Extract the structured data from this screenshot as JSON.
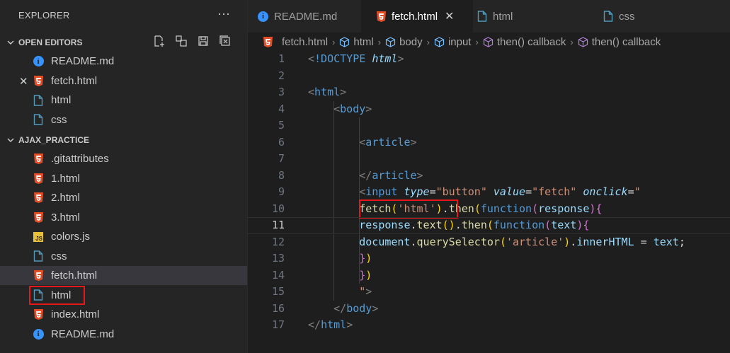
{
  "explorer": {
    "title": "EXPLORER",
    "more": "···",
    "open_editors": {
      "label": "OPEN EDITORS",
      "items": [
        {
          "name": "README.md",
          "icon": "info-icon"
        },
        {
          "name": "fetch.html",
          "icon": "html5-icon",
          "active": true
        },
        {
          "name": "html",
          "icon": "file-icon"
        },
        {
          "name": "css",
          "icon": "file-icon"
        }
      ]
    },
    "project": {
      "label": "AJAX_PRACTICE",
      "items": [
        {
          "name": ".gitattributes",
          "icon": "html5-icon"
        },
        {
          "name": "1.html",
          "icon": "html5-icon"
        },
        {
          "name": "2.html",
          "icon": "html5-icon"
        },
        {
          "name": "3.html",
          "icon": "html5-icon"
        },
        {
          "name": "colors.js",
          "icon": "js-icon"
        },
        {
          "name": "css",
          "icon": "file-icon"
        },
        {
          "name": "fetch.html",
          "icon": "html5-icon",
          "active": true
        },
        {
          "name": "html",
          "icon": "file-icon",
          "highlighted": true
        },
        {
          "name": "index.html",
          "icon": "html5-icon"
        },
        {
          "name": "README.md",
          "icon": "info-icon"
        }
      ]
    }
  },
  "tabs": [
    {
      "label": "README.md",
      "icon": "info-icon"
    },
    {
      "label": "fetch.html",
      "icon": "html5-icon",
      "active": true
    },
    {
      "label": "html",
      "icon": "file-icon"
    },
    {
      "label": "css",
      "icon": "file-icon"
    }
  ],
  "breadcrumb": [
    "fetch.html",
    "html",
    "body",
    "input",
    "then() callback",
    "then() callback"
  ],
  "code_lines": [
    "<!DOCTYPE html>",
    "",
    "<html>",
    "    <body>",
    "",
    "        <article>",
    "",
    "        </article>",
    "        <input type=\"button\" value=\"fetch\" onclick=\"",
    "        fetch('html').then(function(response){",
    "        response.text().then(function(text){",
    "        document.querySelector('article').innerHTML = text;",
    "        })",
    "        })",
    "        \">",
    "    </body>",
    "</html>"
  ],
  "line_numbers": [
    "1",
    "2",
    "3",
    "4",
    "5",
    "6",
    "7",
    "8",
    "9",
    "10",
    "11",
    "12",
    "13",
    "14",
    "15",
    "16",
    "17"
  ],
  "colors": {
    "html5": "#e44d26",
    "info": "#3794ff",
    "file": "#519aba",
    "js": "#e8c13a",
    "highlight": "#e51919"
  }
}
